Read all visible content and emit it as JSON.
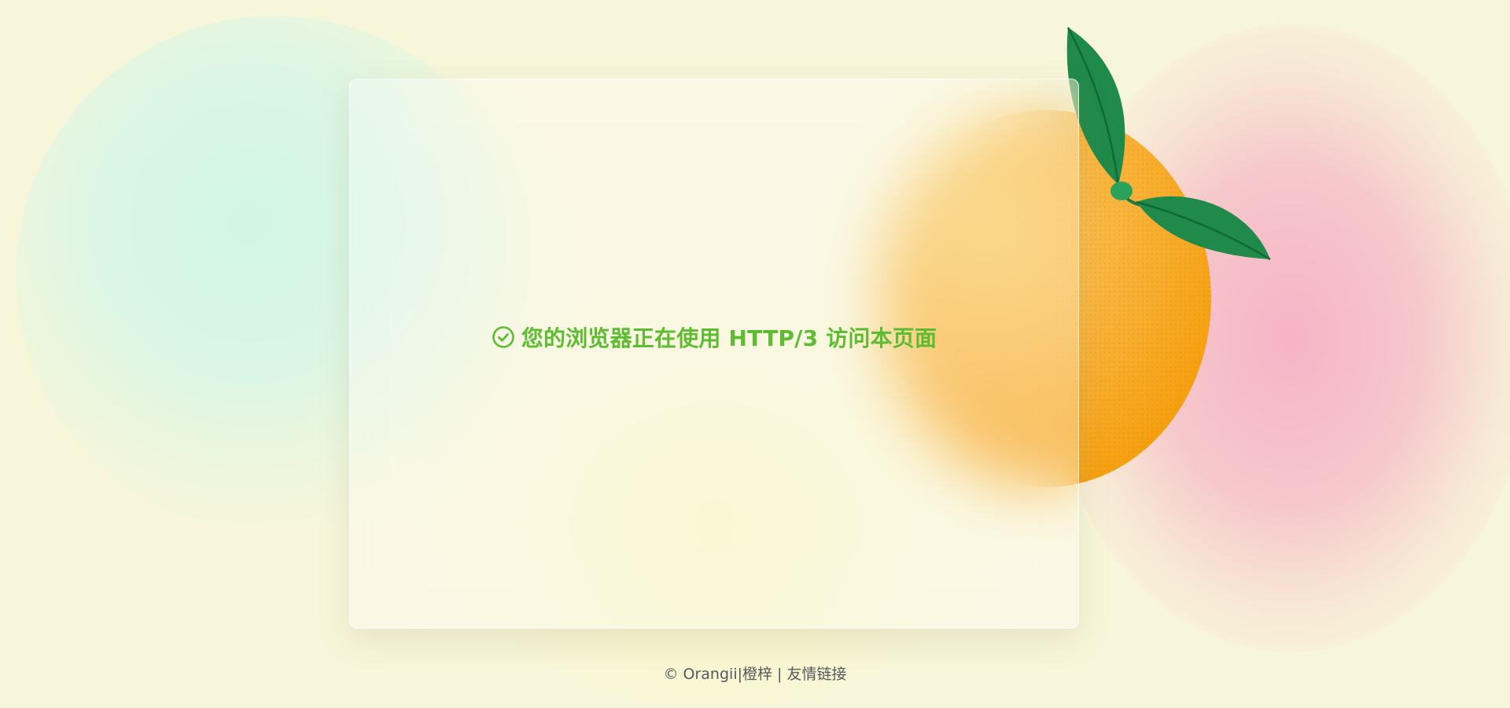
{
  "status": {
    "icon": "check-circle-icon",
    "message": "您的浏览器正在使用 HTTP/3 访问本页面",
    "color": "#5dbc32"
  },
  "footer": {
    "copyright": "© Orangii|橙梓",
    "separator": " | ",
    "link_label": "友情链接"
  },
  "colors": {
    "background": "#f8f6da",
    "mint_blob": "#d0f6e4",
    "pink_blob": "#f6b0c6",
    "orange": "#f59f0e",
    "leaf": "#1f8a4a"
  }
}
